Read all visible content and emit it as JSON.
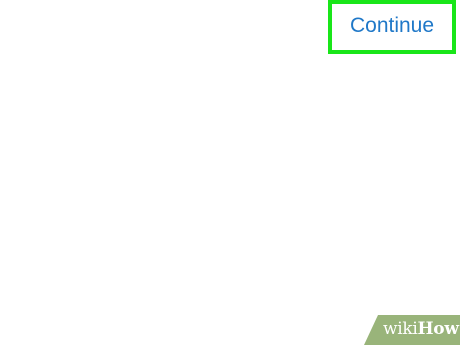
{
  "actions": {
    "continue_label": "Continue"
  },
  "watermark": {
    "part1": "wiki",
    "part2": "How"
  },
  "colors": {
    "background": "#ffffff",
    "link": "#1f78c8",
    "highlight": "#19e619",
    "watermark": "#99b47a"
  }
}
